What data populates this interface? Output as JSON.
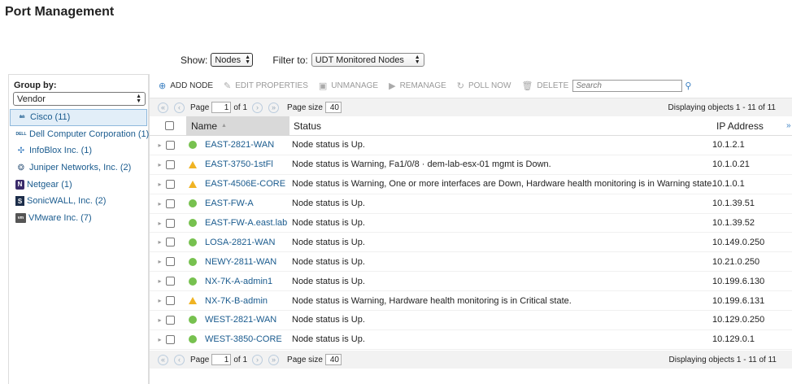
{
  "page": {
    "title": "Port Management"
  },
  "filters": {
    "show_label": "Show:",
    "show_value": "Nodes",
    "filter_label": "Filter to:",
    "filter_value": "UDT Monitored Nodes"
  },
  "group": {
    "label": "Group by:",
    "value": "Vendor",
    "items": [
      {
        "icon": "cisco-logo-icon",
        "label": "Cisco (11)",
        "selected": true
      },
      {
        "icon": "dell-logo-icon",
        "label": "Dell Computer Corporation (1)"
      },
      {
        "icon": "infoblox-logo-icon",
        "label": "InfoBlox Inc. (1)"
      },
      {
        "icon": "juniper-logo-icon",
        "label": "Juniper Networks, Inc. (2)"
      },
      {
        "icon": "netgear-logo-icon",
        "label": "Netgear (1)"
      },
      {
        "icon": "sonicwall-logo-icon",
        "label": "SonicWALL, Inc. (2)"
      },
      {
        "icon": "vmware-logo-icon",
        "label": "VMware Inc. (7)"
      }
    ]
  },
  "toolbar": {
    "add_node": "ADD NODE",
    "edit_properties": "EDIT PROPERTIES",
    "unmanage": "UNMANAGE",
    "remanage": "REMANAGE",
    "poll_now": "POLL NOW",
    "delete": "DELETE",
    "search_placeholder": "Search"
  },
  "pager": {
    "page_label": "Page",
    "page_value": "1",
    "of_label": "of 1",
    "size_label": "Page size",
    "size_value": "40",
    "display_text": "Displaying objects 1 - 11 of 11"
  },
  "grid": {
    "columns": {
      "name": "Name",
      "status": "Status",
      "ip": "IP Address"
    },
    "rows": [
      {
        "name": "EAST-2821-WAN",
        "state": "up",
        "status": "Node status is Up.",
        "ip": "10.1.2.1"
      },
      {
        "name": "EAST-3750-1stFl",
        "state": "warning",
        "status": "Node status is Warning, Fa1/0/8 · dem-lab-esx-01 mgmt is Down.",
        "ip": "10.1.0.21"
      },
      {
        "name": "EAST-4506E-CORE",
        "state": "warning",
        "status": "Node status is Warning, One or more interfaces are Down, Hardware health monitoring is in Warning state.",
        "ip": "10.1.0.1"
      },
      {
        "name": "EAST-FW-A",
        "state": "up",
        "status": "Node status is Up.",
        "ip": "10.1.39.51"
      },
      {
        "name": "EAST-FW-A.east.lab",
        "state": "up",
        "status": "Node status is Up.",
        "ip": "10.1.39.52"
      },
      {
        "name": "LOSA-2821-WAN",
        "state": "up",
        "status": "Node status is Up.",
        "ip": "10.149.0.250"
      },
      {
        "name": "NEWY-2811-WAN",
        "state": "up",
        "status": "Node status is Up.",
        "ip": "10.21.0.250"
      },
      {
        "name": "NX-7K-A-admin1",
        "state": "up",
        "status": "Node status is Up.",
        "ip": "10.199.6.130"
      },
      {
        "name": "NX-7K-B-admin",
        "state": "warning",
        "status": "Node status is Warning, Hardware health monitoring is in Critical state.",
        "ip": "10.199.6.131"
      },
      {
        "name": "WEST-2821-WAN",
        "state": "up",
        "status": "Node status is Up.",
        "ip": "10.129.0.250"
      },
      {
        "name": "WEST-3850-CORE",
        "state": "up",
        "status": "Node status is Up.",
        "ip": "10.129.0.1"
      }
    ]
  },
  "colors": {
    "link": "#1a5b8e",
    "up": "#77c14f",
    "warning": "#f0b323"
  }
}
